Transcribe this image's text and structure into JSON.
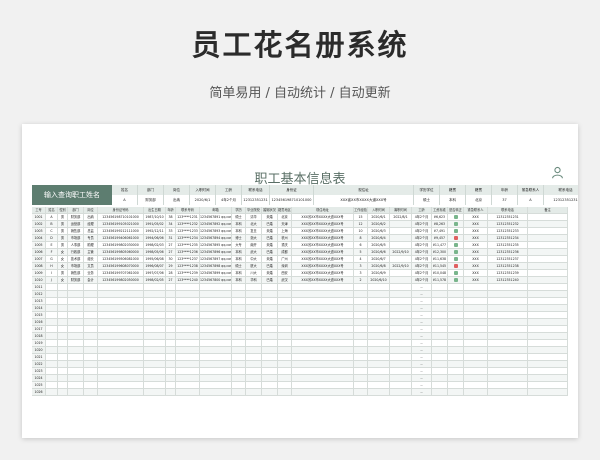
{
  "hero": {
    "title": "员工花名册系统",
    "subtitle": "简单易用 / 自动统计 / 自动更新"
  },
  "sheet": {
    "title": "职工基本信息表",
    "query": {
      "label": "输入查询职工姓名",
      "fields": [
        {
          "h": "姓名",
          "v": "A"
        },
        {
          "h": "部门",
          "v": "财务部"
        },
        {
          "h": "岗位",
          "v": "出纳"
        },
        {
          "h": "入职时间",
          "v": "2020/6/1"
        },
        {
          "h": "工龄",
          "v": "4年2个月"
        },
        {
          "h": "联系电话",
          "v": "12312351231"
        },
        {
          "h": "身份证",
          "v": "123456198710101000"
        },
        {
          "h": "现住址",
          "v": "XXX省XX市XXXX大道XXX号"
        },
        {
          "h": "学历学位",
          "v": "硕士"
        },
        {
          "h": "籍贯",
          "v": "本科"
        },
        {
          "h": "籍贯",
          "v": "北京"
        },
        {
          "h": "年龄",
          "v": "37"
        },
        {
          "h": "紧急联系人",
          "v": "A"
        },
        {
          "h": "联系电话",
          "v": "12312351231"
        }
      ]
    },
    "columns": [
      "工号",
      "姓名",
      "性别",
      "部门",
      "岗位",
      "身份证号码",
      "出生日期",
      "年龄",
      "联系号码",
      "邮箱",
      "学历",
      "毕业院校",
      "婚姻状况",
      "籍贯地区",
      "现住地址",
      "工作经验",
      "入职时间",
      "离职时间",
      "工龄",
      "工资标准",
      "是否转正",
      "紧急联系人",
      "联系电话",
      "备注"
    ],
    "rows": [
      [
        "1001",
        "A",
        "男",
        "财务部",
        "出纳",
        "123456198710101000",
        "1987/10/10",
        "38",
        "123****1231",
        "1234567891 qq.com",
        "硕士",
        "清华",
        "未婚",
        "北京",
        "XXX省XX市XXXX大道XXX号",
        "15",
        "2020/6/1",
        "2022/8/1",
        "4年2个月",
        "¥6,623",
        "",
        "XXX",
        "12312351231",
        ""
      ],
      [
        "1002",
        "B",
        "男",
        "运营部",
        "经理",
        "123456199105021000",
        "1991/05/02",
        "34",
        "123****1232",
        "1234567892 qq.com",
        "本科",
        "北大",
        "已婚",
        "天津",
        "XXX省XX市XXXX大道XXX号",
        "12",
        "2020/6/2",
        "",
        "4年2个月",
        "¥8,263",
        "",
        "XXX",
        "12312351232",
        ""
      ],
      [
        "1003",
        "C",
        "男",
        "销售部",
        "总监",
        "123456199212111000",
        "1992/12/11",
        "33",
        "123****1233",
        "1234567893 qq.com",
        "本科",
        "复旦",
        "未婚",
        "上海",
        "XXX省XX市XXXX大道XXX号",
        "10",
        "2020/6/3",
        "",
        "4年2个月",
        "¥7,491",
        "",
        "XXX",
        "12312351233",
        ""
      ],
      [
        "1004",
        "D",
        "男",
        "市场部",
        "专员",
        "123456199406061000",
        "1994/06/06",
        "31",
        "123****1234",
        "1234567894 qq.com",
        "博士",
        "浙大",
        "已婚",
        "杭州",
        "XXX省XX市XXXX大道XXX号",
        "8",
        "2020/6/4",
        "",
        "4年2个月",
        "¥9,457",
        "",
        "XXX",
        "12312351234",
        ""
      ],
      [
        "1005",
        "E",
        "男",
        "人事部",
        "助理",
        "123456199802030000",
        "1998/02/03",
        "27",
        "123****1235",
        "1234567895 qq.com",
        "大专",
        "南开",
        "未婚",
        "重庆",
        "XXX省XX市XXXX大道XXX号",
        "6",
        "2020/6/5",
        "",
        "4年2个月",
        "¥11,477",
        "",
        "XXX",
        "12312351235",
        ""
      ],
      [
        "1006",
        "F",
        "女",
        "行政部",
        "主管",
        "123456199805060000",
        "1998/05/06",
        "27",
        "123****1236",
        "1234567896 qq.com",
        "本科",
        "武大",
        "已婚",
        "成都",
        "XXX省XX市XXXX大道XXX号",
        "5",
        "2020/6/6",
        "2022/9/10",
        "4年2个月",
        "¥12,300",
        "",
        "XXX",
        "12312351236",
        ""
      ],
      [
        "1007",
        "G",
        "女",
        "技术部",
        "组长",
        "123456199506081000",
        "1995/06/08",
        "30",
        "123****1237",
        "1234567897 qq.com",
        "本科",
        "中大",
        "未婚",
        "广州",
        "XXX省XX市XXXX大道XXX号",
        "4",
        "2020/6/7",
        "",
        "4年2个月",
        "¥11,638",
        "",
        "XXX",
        "12312351237",
        ""
      ],
      [
        "1008",
        "H",
        "女",
        "市场部",
        "文员",
        "123456199608070000",
        "1996/08/07",
        "29",
        "123****1238",
        "1234567898 qq.com",
        "硕士",
        "厦大",
        "已婚",
        "深圳",
        "XXX省XX市XXXX大道XXX号",
        "3",
        "2020/6/8",
        "2022/9/10",
        "4年2个月",
        "¥11,545",
        "",
        "XXX",
        "12312351238",
        ""
      ],
      [
        "1009",
        "I",
        "男",
        "销售部",
        "业务",
        "123456199707061000",
        "1997/07/06",
        "28",
        "123****1239",
        "1234567899 qq.com",
        "本科",
        "川大",
        "未婚",
        "西安",
        "XXX省XX市XXXX大道XXX号",
        "3",
        "2020/6/9",
        "",
        "4年2个月",
        "¥10,048",
        "",
        "XXX",
        "12312351239",
        ""
      ],
      [
        "1010",
        "J",
        "女",
        "财务部",
        "会计",
        "123456199802050000",
        "1998/02/05",
        "27",
        "123****1240",
        "1234567800 qq.com",
        "本科",
        "华科",
        "已婚",
        "武汉",
        "XXX省XX市XXXX大道XXX号",
        "2",
        "2020/6/10",
        "",
        "4年2个月",
        "¥11,578",
        "",
        "XXX",
        "12312351240",
        ""
      ]
    ],
    "empty_ids": [
      "1011",
      "1012",
      "1013",
      "1014",
      "1015",
      "1016",
      "1017",
      "1018",
      "1019",
      "1020",
      "1021",
      "1022",
      "1023",
      "1024",
      "1025",
      "1026"
    ],
    "empty_gl": "--",
    "colors": {
      "accent": "#5d7d70",
      "header": "#e4ebe8",
      "red_mark": "#e06060",
      "green_mark": "#79b58c"
    }
  }
}
